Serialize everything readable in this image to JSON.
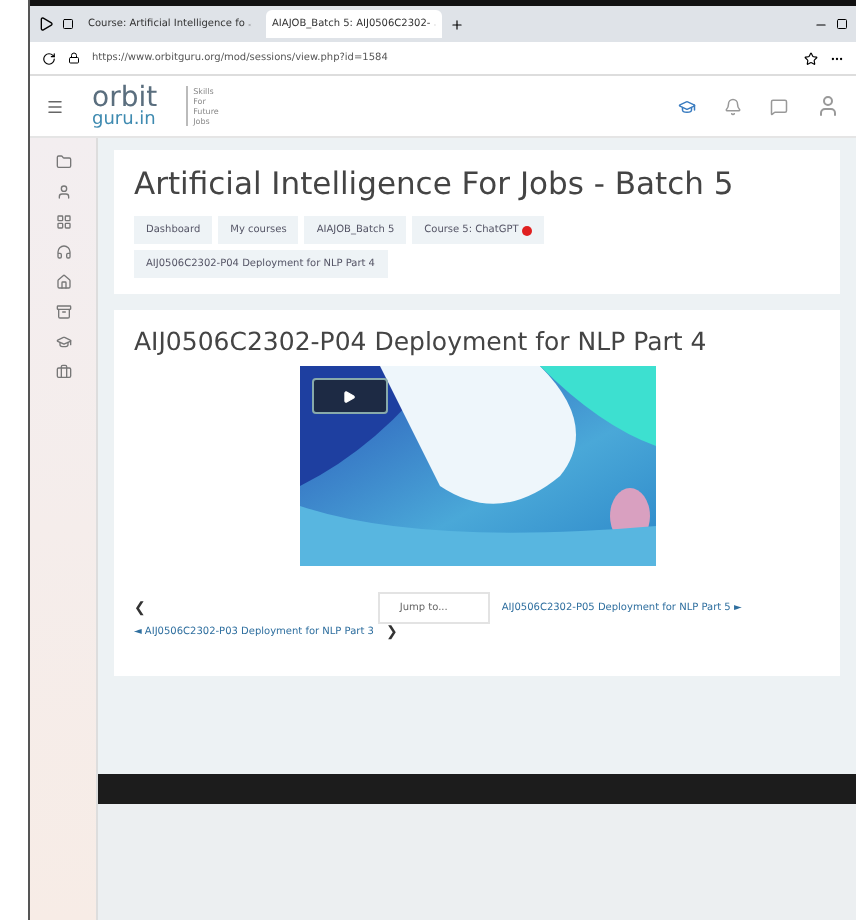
{
  "browser": {
    "tabs": [
      {
        "label": "Course: Artificial Intelligence fo",
        "selected": false
      },
      {
        "label": "AIAJOB_Batch 5: AIJ0506C2302-",
        "selected": true
      }
    ],
    "url": "https://www.orbitguru.org/mod/sessions/view.php?id=1584"
  },
  "site": {
    "logo_top": "orbit",
    "logo_bottom": "guru.in",
    "tagline": "Skills For Future Jobs"
  },
  "course": {
    "title": "Artificial Intelligence For Jobs - Batch 5",
    "breadcrumbs": [
      {
        "label": "Dashboard",
        "alert": false
      },
      {
        "label": "My courses",
        "alert": false
      },
      {
        "label": "AIAJOB_Batch 5",
        "alert": false
      },
      {
        "label": "Course 5: ChatGPT",
        "alert": true
      },
      {
        "label": "AIJ0506C2302-P04 Deployment for NLP Part 4",
        "alert": false
      }
    ]
  },
  "lesson": {
    "title": "AIJ0506C2302-P04 Deployment for NLP Part 4",
    "nav": {
      "prev_arrow": "❮",
      "jump": "Jump to...",
      "next_link": "AIJ0506C2302-P05 Deployment for NLP Part 5 ►",
      "prev_link": "◄ AIJ0506C2302-P03 Deployment for NLP Part 3",
      "next_arrow": "❯"
    }
  }
}
